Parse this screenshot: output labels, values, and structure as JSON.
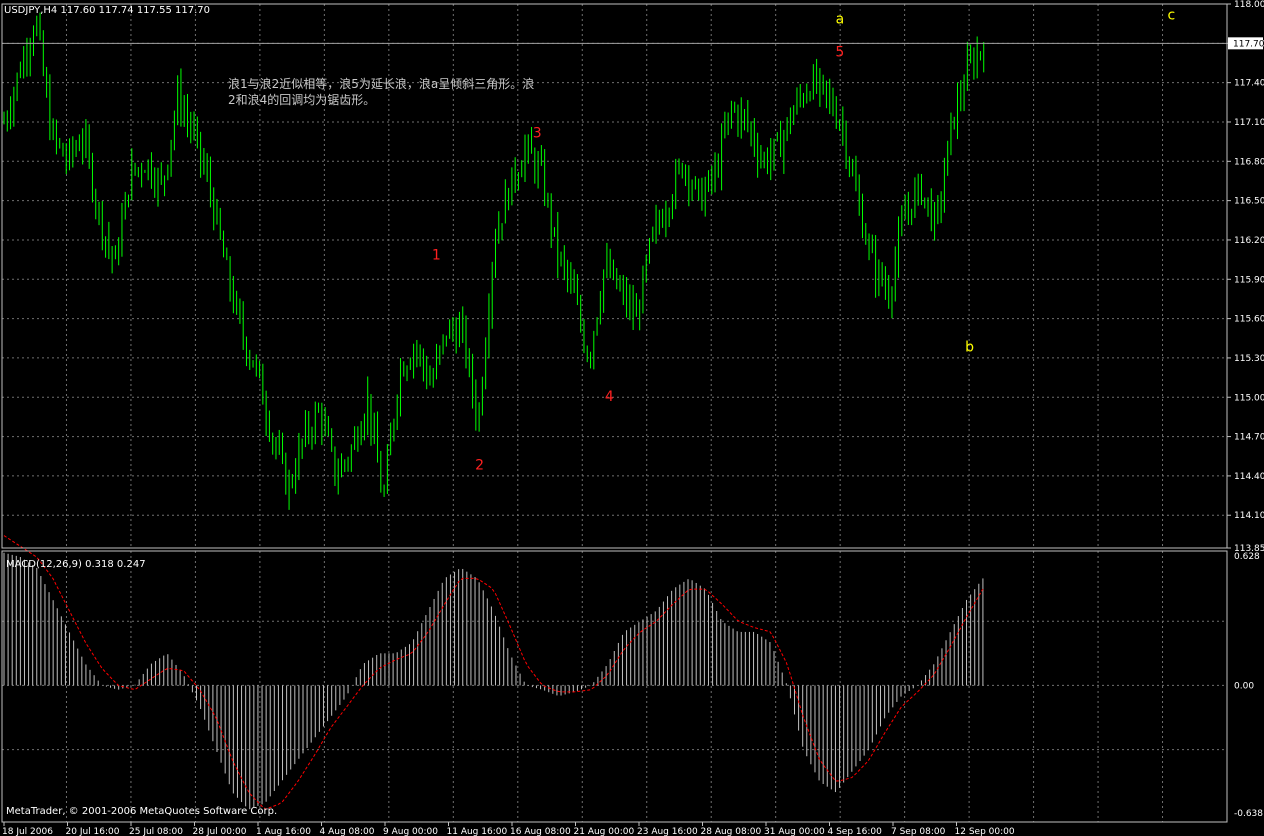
{
  "header": {
    "symbol_line": "USDJPY,H4  117.60 117.74 117.55 117.70"
  },
  "annotation": {
    "line1": "浪1与浪2近似相等，浪5为延长浪，浪a呈倾斜三角形。浪",
    "line2": "2和浪4的回调均为锯齿形。"
  },
  "macd": {
    "title": "MACD(12,26,9) 0.318 0.247"
  },
  "copyright": "MetaTrader, © 2001-2006 MetaQuotes Software Corp.",
  "colors": {
    "background": "#000000",
    "grid": "#707070",
    "candle": "#00ff00",
    "wave_label_red": "#ff2020",
    "wave_label_yellow": "#ffff00",
    "macd_hist": "#c0c0c0",
    "macd_signal": "#ff0000",
    "axis_text": "#ffffff"
  },
  "chart_data": [
    {
      "type": "candlestick",
      "title": "USDJPY,H4",
      "ylim": [
        113.85,
        118.0
      ],
      "y_ticks": [
        "118.00",
        "117.70",
        "117.40",
        "117.10",
        "116.80",
        "116.50",
        "116.20",
        "115.90",
        "115.60",
        "115.30",
        "115.00",
        "114.70",
        "114.40",
        "114.10",
        "113.85"
      ],
      "current_price": "117.70",
      "x_ticks": [
        "18 Jul 2006",
        "20 Jul 16:00",
        "25 Jul 08:00",
        "28 Jul 00:00",
        "1 Aug 16:00",
        "4 Aug 08:00",
        "9 Aug 00:00",
        "11 Aug 16:00",
        "16 Aug 08:00",
        "21 Aug 00:00",
        "23 Aug 16:00",
        "28 Aug 08:00",
        "31 Aug 00:00",
        "4 Sep 16:00",
        "7 Sep 08:00",
        "12 Sep 00:00"
      ],
      "price_path": [
        117.1,
        117.5,
        117.9,
        117.0,
        116.8,
        117.0,
        116.4,
        116.0,
        116.7,
        116.8,
        116.6,
        117.3,
        117.0,
        116.6,
        116.0,
        115.5,
        115.2,
        114.7,
        114.3,
        114.7,
        114.9,
        114.4,
        114.6,
        115.0,
        114.2,
        115.2,
        115.4,
        115.1,
        115.5,
        115.5,
        114.8,
        116.2,
        116.6,
        116.9,
        116.7,
        116.1,
        115.8,
        115.3,
        116.0,
        115.8,
        115.6,
        116.2,
        116.5,
        116.8,
        116.5,
        116.7,
        117.2,
        117.1,
        116.8,
        116.9,
        117.2,
        117.4,
        117.3,
        117.1,
        116.5,
        116.0,
        115.8,
        116.4,
        116.6,
        116.3,
        117.1,
        117.5,
        117.7
      ],
      "wave_labels": [
        {
          "text": "1",
          "price": 116.05,
          "index": 30
        },
        {
          "text": "2",
          "price": 114.45,
          "index": 33
        },
        {
          "text": "3",
          "price": 116.98,
          "index": 37
        },
        {
          "text": "4",
          "price": 114.97,
          "index": 42
        },
        {
          "text": "5",
          "price": 117.6,
          "index": 58
        },
        {
          "text": "a",
          "price": 117.85,
          "index": 58
        },
        {
          "text": "b",
          "price": 115.35,
          "index": 67
        },
        {
          "text": "c",
          "price": 117.88,
          "index": 81
        }
      ]
    },
    {
      "type": "bar",
      "title": "MACD(12,26,9)",
      "ylim": [
        -0.638,
        0.628
      ],
      "y_ticks": [
        "0.628",
        "0.00",
        "-0.638"
      ],
      "macd_value": 0.318,
      "signal_value": 0.247,
      "macd_path": [
        0.62,
        0.6,
        0.55,
        0.4,
        0.25,
        0.1,
        0.0,
        -0.02,
        0.0,
        0.1,
        0.15,
        0.05,
        -0.1,
        -0.3,
        -0.5,
        -0.58,
        -0.55,
        -0.45,
        -0.35,
        -0.25,
        -0.15,
        -0.05,
        0.1,
        0.15,
        0.15,
        0.2,
        0.35,
        0.5,
        0.55,
        0.5,
        0.35,
        0.15,
        0.0,
        -0.02,
        -0.05,
        -0.03,
        0.0,
        0.1,
        0.25,
        0.3,
        0.35,
        0.45,
        0.5,
        0.45,
        0.3,
        0.25,
        0.25,
        0.2,
        0.0,
        -0.3,
        -0.45,
        -0.5,
        -0.4,
        -0.3,
        -0.15,
        -0.05,
        0.0,
        0.1,
        0.25,
        0.4,
        0.5
      ],
      "signal_path": [
        0.7,
        0.65,
        0.6,
        0.5,
        0.35,
        0.2,
        0.08,
        0.0,
        -0.02,
        0.03,
        0.08,
        0.07,
        -0.02,
        -0.15,
        -0.35,
        -0.5,
        -0.58,
        -0.55,
        -0.45,
        -0.33,
        -0.2,
        -0.1,
        0.0,
        0.08,
        0.12,
        0.15,
        0.25,
        0.38,
        0.5,
        0.5,
        0.45,
        0.28,
        0.1,
        0.0,
        -0.03,
        -0.03,
        -0.02,
        0.05,
        0.17,
        0.25,
        0.3,
        0.38,
        0.45,
        0.45,
        0.38,
        0.3,
        0.27,
        0.25,
        0.1,
        -0.15,
        -0.35,
        -0.45,
        -0.43,
        -0.35,
        -0.22,
        -0.1,
        -0.03,
        0.05,
        0.18,
        0.32,
        0.45
      ]
    }
  ]
}
